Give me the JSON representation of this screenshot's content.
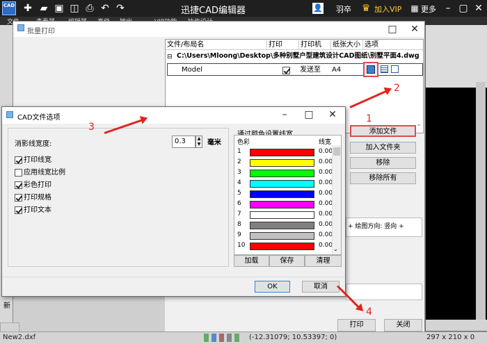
{
  "app": {
    "logo_text": "CAD",
    "title": "迅捷CAD编辑器",
    "user": "羽卒",
    "vip": "加入VIP",
    "more": "更多",
    "menu": [
      "文件",
      "查看器",
      "编辑器",
      "高级",
      "输出",
      "VIP功能",
      "协作设计"
    ]
  },
  "batch_dialog": {
    "title": "批量打印",
    "columns": [
      "文件/布局名",
      "打印",
      "打印机",
      "纸张大小",
      "选项"
    ],
    "file_path": "C:\\Users\\Mloong\\Desktop\\多种别墅户型建筑设计CAD图纸\\别墅平面4.dwg",
    "row": {
      "name": "Model",
      "print": true,
      "printer": "发送至",
      "paper": "A4"
    },
    "side_buttons": [
      "添加文件",
      "加入文件夹",
      "移除",
      "移除所有"
    ],
    "orientation_text": "+ 绘图方向: 竖向 +",
    "left_label": "新",
    "print_button": "打印",
    "close_button": "关闭"
  },
  "options_dialog": {
    "title": "CAD文件选项",
    "line_width_label": "消影线宽度:",
    "line_width_value": "0.3",
    "unit": "毫米",
    "checkboxes": [
      {
        "label": "打印线宽",
        "checked": true
      },
      {
        "label": "应用线宽比例",
        "checked": false
      },
      {
        "label": "彩色打印",
        "checked": true
      },
      {
        "label": "打印规格",
        "checked": true
      },
      {
        "label": "打印文本",
        "checked": true
      }
    ],
    "color_group_title": "通过颜色设置线宽",
    "color_header": "色彩",
    "width_header": "线宽",
    "colors": [
      {
        "num": "1",
        "color": "#ff0000",
        "width": "0.00"
      },
      {
        "num": "2",
        "color": "#ffff00",
        "width": "0.00"
      },
      {
        "num": "3",
        "color": "#00ff00",
        "width": "0.00"
      },
      {
        "num": "4",
        "color": "#00ffff",
        "width": "0.00"
      },
      {
        "num": "5",
        "color": "#0000ff",
        "width": "0.00"
      },
      {
        "num": "6",
        "color": "#ff00ff",
        "width": "0.00"
      },
      {
        "num": "7",
        "color": "#ffffff",
        "width": "0.00"
      },
      {
        "num": "8",
        "color": "#808080",
        "width": "0.00"
      },
      {
        "num": "9",
        "color": "#c0c0c0",
        "width": "0.00"
      },
      {
        "num": "10",
        "color": "#ff0000",
        "width": "0.00"
      }
    ],
    "bottom_buttons": [
      "加载",
      "保存",
      "清理"
    ],
    "ok": "OK",
    "cancel": "取消"
  },
  "status": {
    "file": "New2.dxf",
    "coords": "(-12.31079; 10.53397; 0)",
    "size": "297 x 210 x 0"
  },
  "annotations": [
    "1",
    "2",
    "3",
    "4"
  ],
  "accent_colors": {
    "annotation": "#e4231c",
    "highlight_box": "#e24a4a"
  }
}
